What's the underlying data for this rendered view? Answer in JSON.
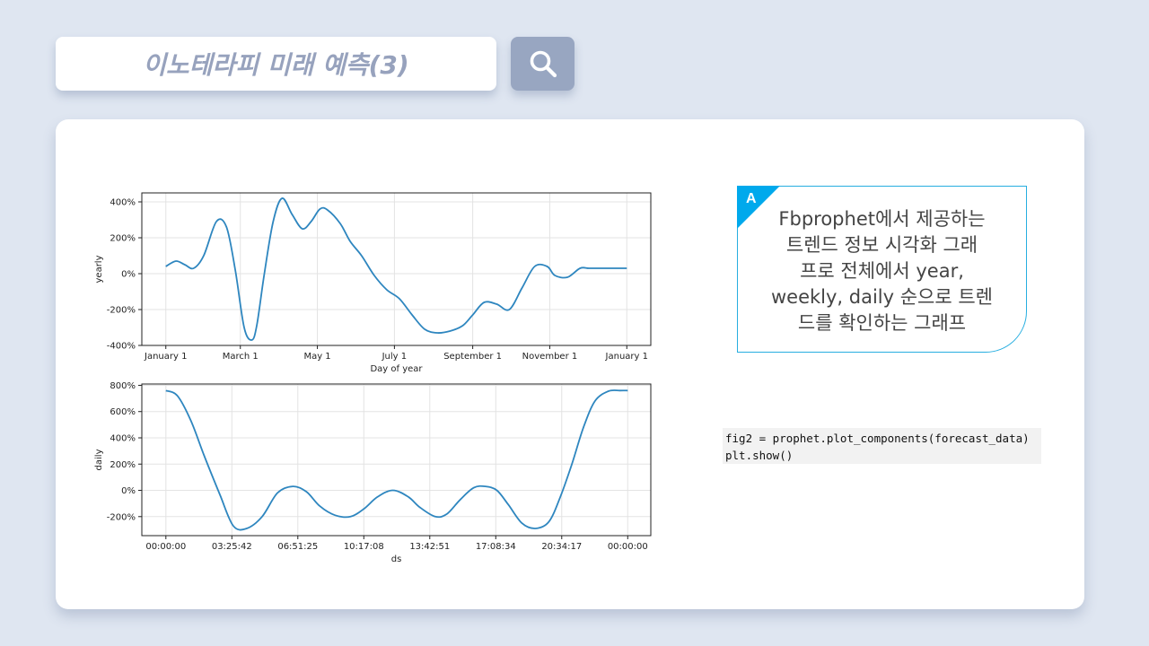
{
  "header": {
    "title": "이노테라피 미래 예측(3)"
  },
  "search_button": {
    "icon": "search-icon"
  },
  "callout": {
    "badge": "A",
    "text_lines": [
      "Fbprophet에서 제공하는",
      "트렌드 정보 시각화 그래",
      "프로 전체에서 year,",
      "weekly, daily 순으로 트렌",
      "드를 확인하는 그래프"
    ],
    "accent_color": "#00a9ec"
  },
  "code": {
    "lines": [
      "fig2 = prophet.plot_components(forecast_data)",
      "plt.show()"
    ]
  },
  "chart_data": [
    {
      "type": "line",
      "xlabel": "Day of year",
      "ylabel": "yearly",
      "x_ticks": [
        "January 1",
        "March 1",
        "May 1",
        "July 1",
        "September 1",
        "November 1",
        "January 1"
      ],
      "x_tick_days": [
        0,
        59,
        120,
        181,
        243,
        304,
        365
      ],
      "y_ticks": [
        "400%",
        "200%",
        "0%",
        "-200%",
        "-400%"
      ],
      "ylim": [
        -400,
        450
      ],
      "xlim": [
        -19,
        384
      ],
      "grid": true,
      "line_color": "#2e86bf",
      "series": [
        {
          "x": [
            0,
            8,
            15,
            22,
            30,
            40,
            48,
            55,
            62,
            68,
            72,
            78,
            85,
            92,
            100,
            108,
            115,
            122,
            128,
            138,
            146,
            155,
            165,
            175,
            185,
            195,
            205,
            215,
            225,
            235,
            243,
            252,
            262,
            272,
            282,
            292,
            302,
            308,
            318,
            328,
            335,
            345,
            355,
            365
          ],
          "y": [
            40,
            70,
            50,
            30,
            100,
            290,
            260,
            20,
            -300,
            -370,
            -290,
            0,
            290,
            420,
            330,
            250,
            290,
            360,
            355,
            280,
            180,
            100,
            -10,
            -90,
            -140,
            -230,
            -310,
            -330,
            -320,
            -290,
            -230,
            -160,
            -170,
            -200,
            -80,
            40,
            40,
            -10,
            -20,
            30,
            30,
            30,
            30,
            30
          ]
        }
      ]
    },
    {
      "type": "line",
      "xlabel": "ds",
      "ylabel": "daily",
      "x_ticks": [
        "00:00:00",
        "03:25:42",
        "06:51:25",
        "10:17:08",
        "13:42:51",
        "17:08:34",
        "20:34:17",
        "00:00:00"
      ],
      "x_tick_hours": [
        0,
        3.4286,
        6.8571,
        10.2857,
        13.7143,
        17.1429,
        20.5714,
        24
      ],
      "y_ticks": [
        "800%",
        "600%",
        "400%",
        "200%",
        "0%",
        "-200%"
      ],
      "ylim": [
        -345,
        810
      ],
      "xlim": [
        -1.25,
        25.2
      ],
      "grid": true,
      "line_color": "#2e86bf",
      "series": [
        {
          "x": [
            0,
            0.6,
            1.3,
            2.0,
            2.8,
            3.5,
            4.2,
            5.0,
            5.8,
            6.6,
            7.3,
            8.0,
            8.8,
            9.6,
            10.3,
            11.0,
            11.8,
            12.6,
            13.2,
            14.0,
            14.6,
            15.3,
            16.0,
            16.6,
            17.2,
            17.8,
            18.5,
            19.2,
            19.9,
            20.5,
            21.1,
            21.7,
            22.3,
            23.0,
            23.6,
            24.0
          ],
          "y": [
            760,
            720,
            530,
            260,
            -30,
            -270,
            -290,
            -200,
            -20,
            30,
            -10,
            -120,
            -190,
            -200,
            -140,
            -50,
            0,
            -50,
            -130,
            -200,
            -180,
            -70,
            20,
            30,
            0,
            -110,
            -250,
            -290,
            -240,
            -50,
            200,
            480,
            680,
            755,
            760,
            760
          ]
        }
      ]
    }
  ]
}
